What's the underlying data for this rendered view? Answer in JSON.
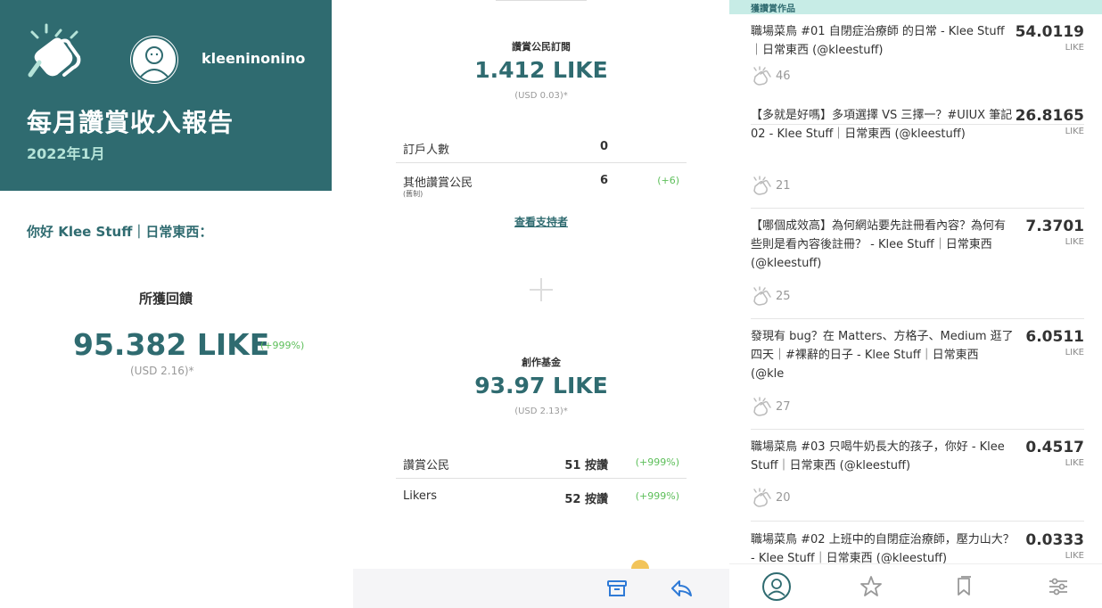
{
  "report": {
    "username": "kleeninonino",
    "title": "每月讚賞收入報告",
    "date": "2022年1月",
    "greeting": "你好 Klee Stuff｜日常東西：",
    "earnings_label": "所獲回饋",
    "earnings_total": "95.382 LIKE",
    "earnings_change": "(+999%)",
    "earnings_usd": "(USD 2.16)*"
  },
  "subscription": {
    "label": "讚賞公民訂閱",
    "value": "1.412 LIKE",
    "usd": "(USD 0.03)*",
    "rows": [
      {
        "label": "訂戶人數",
        "value": "0",
        "change": ""
      },
      {
        "label": "其他讚賞公民",
        "sub": "(舊制)",
        "value": "6",
        "change": "(+6)"
      }
    ],
    "support_link": "查看支持者"
  },
  "fund": {
    "label": "創作基金",
    "value": "93.97 LIKE",
    "usd": "(USD 2.13)*",
    "rows": [
      {
        "label": "讚賞公民",
        "value": "51 按讚",
        "change": "(+999%)"
      },
      {
        "label": "Likers",
        "value": "52 按讚",
        "change": "(+999%)"
      }
    ]
  },
  "works_header": "獲讚賞作品",
  "works": [
    {
      "title": "職場菜鳥 #01 自閉症治療師 的日常 - Klee Stuff｜日常東西 (@kleestuff)",
      "like": "54.0119",
      "unit": "LIKE",
      "claps": "46"
    },
    {
      "title": "【多就是好嗎】多項選擇 VS 三擇一？#UIUX 筆記 02 - Klee Stuff｜日常東西 (@kleestuff)",
      "like": "26.8165",
      "unit": "LIKE",
      "claps": "21"
    },
    {
      "title": "【哪個成效高】為何網站要先註冊看內容？為何有些則是看內容後註冊？ - Klee Stuff｜日常東西 (@kleestuff)",
      "like": "7.3701",
      "unit": "LIKE",
      "claps": "25"
    },
    {
      "title": "發現有 bug？在 Matters、方格子、Medium 逛了四天｜#裸辭的日子 - Klee Stuff｜日常東西 (@kle",
      "like": "6.0511",
      "unit": "LIKE",
      "claps": "27"
    },
    {
      "title": "職場菜鳥 #03 只喝牛奶長大的孩子，你好 - Klee Stuff｜日常東西 (@kleestuff)",
      "like": "0.4517",
      "unit": "LIKE",
      "claps": "20"
    },
    {
      "title": "職場菜鳥 #02 上班中的自閉症治療師，壓力山大？ - Klee Stuff｜日常東西 (@kleestuff)",
      "like": "0.0333",
      "unit": "LIKE",
      "claps": ""
    }
  ],
  "icons": {
    "logo": "clap-hands-icon",
    "avatar": "user-avatar",
    "archive": "archive-icon",
    "reply": "reply-icon",
    "nav": [
      "profile-icon",
      "star-icon",
      "bookmark-icon",
      "settings-sliders-icon"
    ]
  },
  "colors": {
    "brand": "#2f6b70",
    "accent_light": "#b5e3d8",
    "positive": "#5dbf5a",
    "header_tint": "#c7ece6"
  }
}
